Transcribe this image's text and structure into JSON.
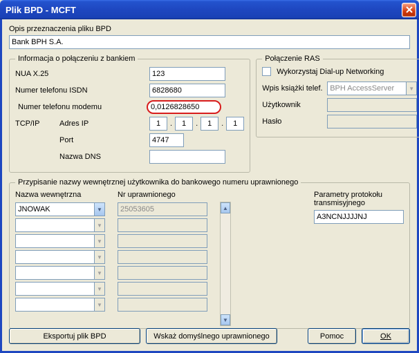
{
  "window": {
    "title": "Plik BPD - MCFT"
  },
  "desc": {
    "label": "Opis przeznaczenia pliku BPD",
    "value": "Bank BPH S.A."
  },
  "conn": {
    "legend": "Informacja o połączeniu z bankiem",
    "nua_label": "NUA X.25",
    "nua_value": "123",
    "isdn_label": "Numer telefonu ISDN",
    "isdn_value": "6828680",
    "modem_label": "Numer telefonu modemu",
    "modem_value": "0,0126828650",
    "tcpip_label": "TCP/IP",
    "ip_label": "Adres IP",
    "ip1": "1",
    "ip2": "1",
    "ip3": "1",
    "ip4": "1",
    "port_label": "Port",
    "port_value": "4747",
    "dns_label": "Nazwa DNS",
    "dns_value": ""
  },
  "ras": {
    "legend": "Połączenie RAS",
    "use_dialup_label": "Wykorzystaj Dial-up Networking",
    "entry_label": "Wpis książki telef.",
    "entry_value": "BPH AccessServer",
    "user_label": "Użytkownik",
    "user_value": "",
    "pass_label": "Hasło",
    "pass_value": ""
  },
  "assign": {
    "legend": "Przypisanie nazwy wewnętrznej użytkownika do bankowego numeru uprawnionego",
    "name_label": "Nazwa wewnętrzna",
    "num_label": "Nr uprawnionego",
    "rows": [
      {
        "name": "JNOWAK",
        "num": "25053605"
      },
      {
        "name": "",
        "num": ""
      },
      {
        "name": "",
        "num": ""
      },
      {
        "name": "",
        "num": ""
      },
      {
        "name": "",
        "num": ""
      },
      {
        "name": "",
        "num": ""
      },
      {
        "name": "",
        "num": ""
      }
    ],
    "param_label": "Parametry protokołu transmisyjnego",
    "param_value": "A3NCNJJJJNJ"
  },
  "buttons": {
    "export": "Eksportuj plik BPD",
    "assign_default": "Wskaż domyślnego uprawnionego",
    "help": "Pomoc",
    "ok": "OK"
  }
}
